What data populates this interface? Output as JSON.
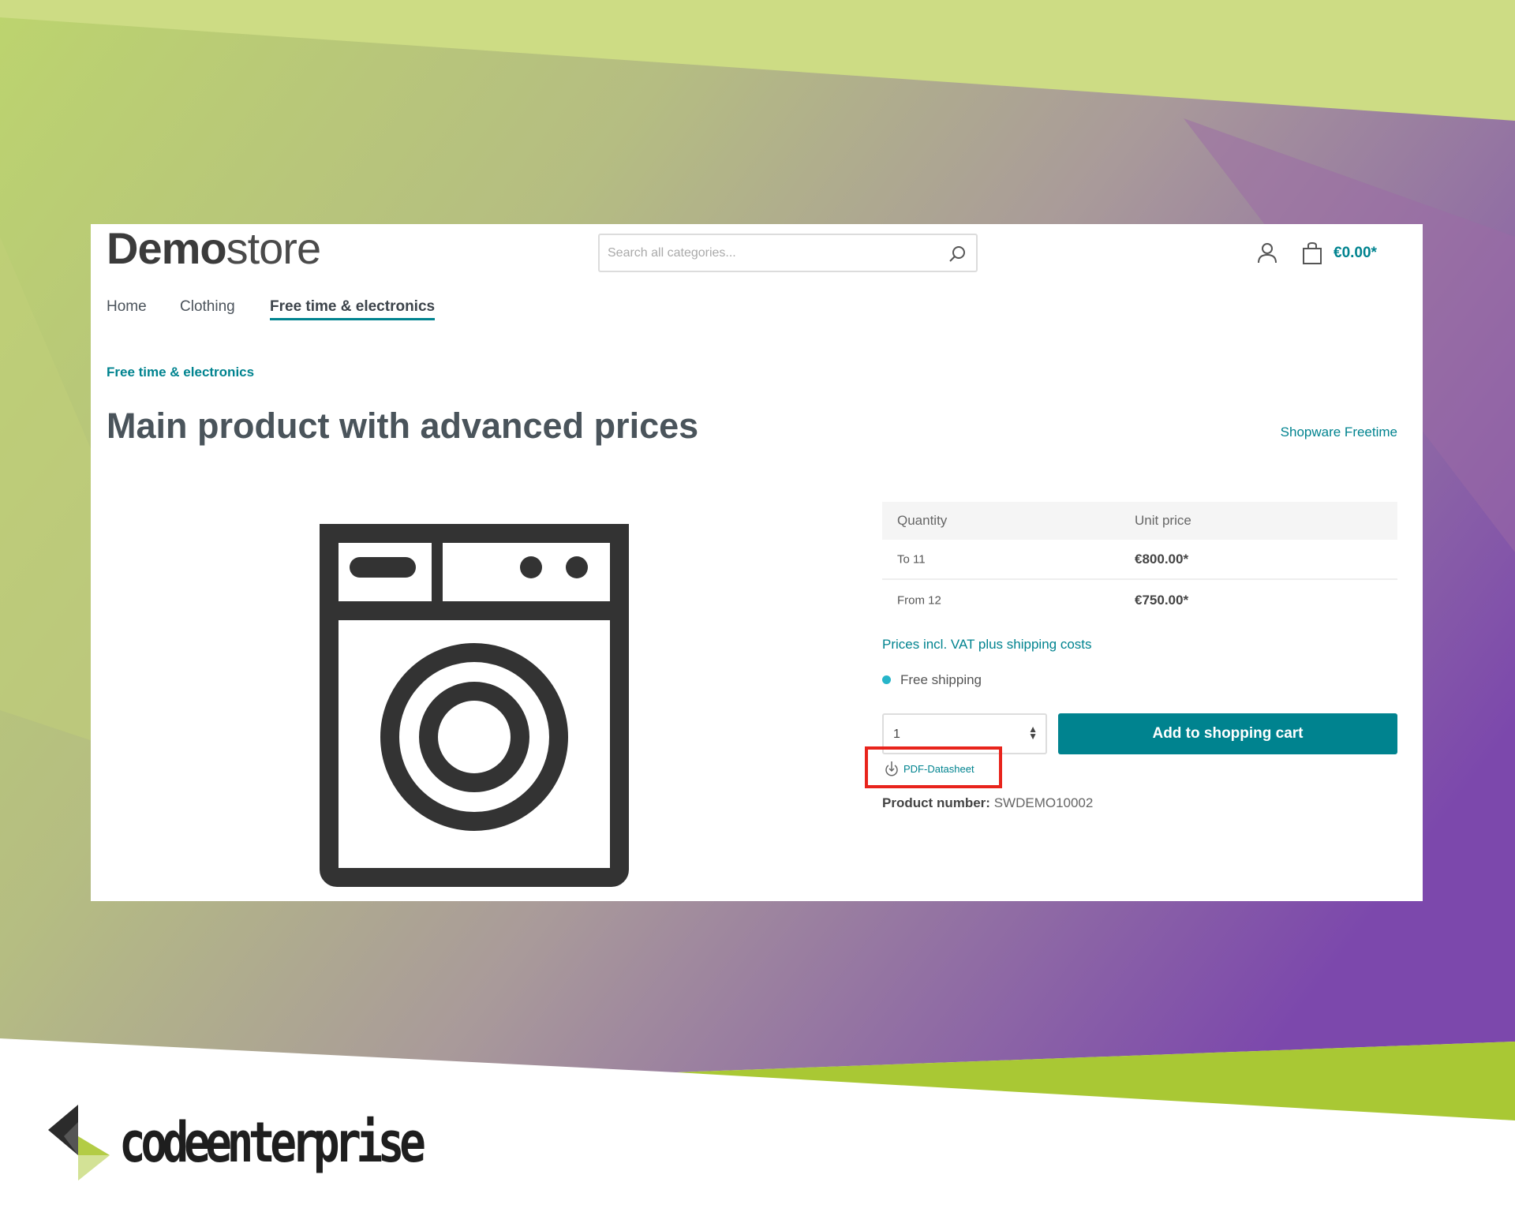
{
  "colors": {
    "accent": "#00838f",
    "highlight_box": "#e8241c",
    "bg_green": "#c5d877",
    "bg_purple": "#8a5bb0",
    "footer_green": "#a9c834"
  },
  "header": {
    "logo_bold": "Demo",
    "logo_light": "store",
    "search_placeholder": "Search all categories...",
    "cart_total": "€0.00*"
  },
  "nav": [
    "Home",
    "Clothing",
    "Free time & electronics"
  ],
  "breadcrumb": "Free time & electronics",
  "product": {
    "title": "Main product with advanced prices",
    "manufacturer": "Shopware Freetime",
    "image_icon": "washing-machine-icon",
    "price_table": {
      "headers": [
        "Quantity",
        "Unit price"
      ],
      "rows": [
        {
          "qty": "To 11",
          "price": "€800.00*"
        },
        {
          "qty": "From 12",
          "price": "€750.00*"
        }
      ]
    },
    "vat_note": "Prices incl. VAT plus shipping costs",
    "shipping": "Free shipping",
    "quantity": "1",
    "add_to_cart": "Add to shopping cart",
    "pdf_link": "PDF-Datasheet",
    "product_number_label": "Product number:",
    "product_number": "SWDEMO10002"
  },
  "footer": {
    "brand": "codeenterprise"
  }
}
